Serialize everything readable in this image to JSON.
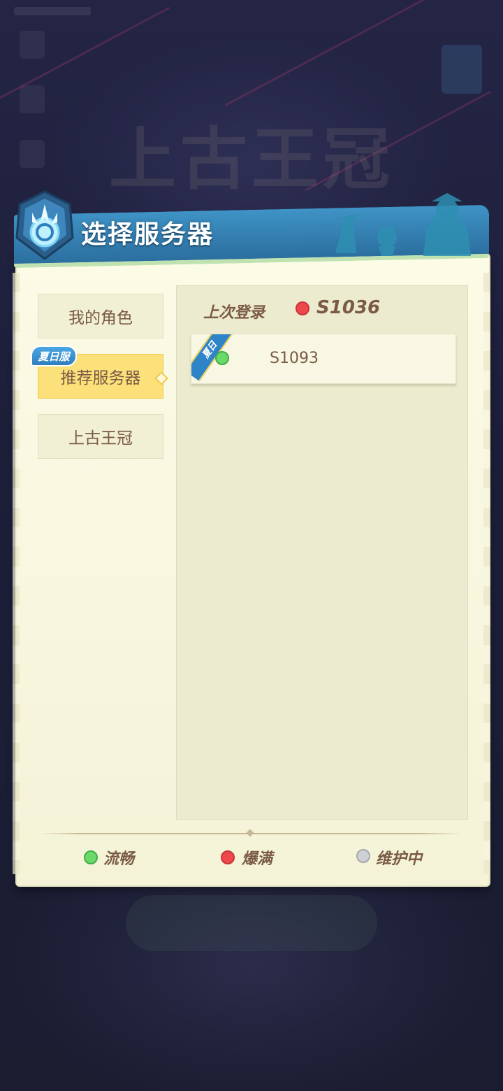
{
  "background": {
    "logo_text": "上古王冠"
  },
  "dialog": {
    "title": "选择服务器",
    "tabs": [
      {
        "label": "我的角色",
        "active": false
      },
      {
        "label": "推荐服务器",
        "active": true,
        "badge": "夏日服"
      },
      {
        "label": "上古王冠",
        "active": false
      }
    ],
    "last_login": {
      "label": "上次登录",
      "server": "S1036",
      "status": "爆满"
    },
    "servers": [
      {
        "name": "S1093",
        "ribbon": "夏日",
        "status": "流畅"
      }
    ],
    "legend": [
      {
        "label": "流畅",
        "color": "#6bd86a"
      },
      {
        "label": "爆满",
        "color": "#f0474a"
      },
      {
        "label": "维护中",
        "color": "#cfd0d4"
      }
    ]
  }
}
